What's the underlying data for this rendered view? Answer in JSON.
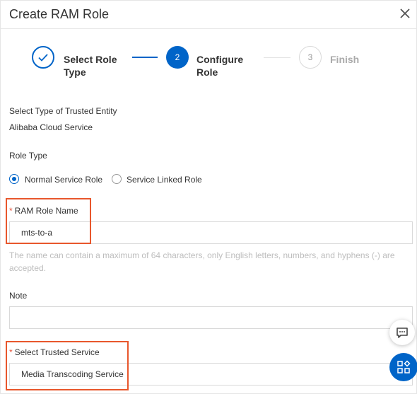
{
  "dialog": {
    "title": "Create RAM Role"
  },
  "steps": [
    {
      "number": "1",
      "label": "Select Role Type",
      "status": "completed"
    },
    {
      "number": "2",
      "label": "Configure Role",
      "status": "active"
    },
    {
      "number": "3",
      "label": "Finish",
      "status": "pending"
    }
  ],
  "form": {
    "trusted_entity_label": "Select Type of Trusted Entity",
    "trusted_entity_value": "Alibaba Cloud Service",
    "role_type_label": "Role Type",
    "role_type_options": [
      {
        "label": "Normal Service Role",
        "selected": true
      },
      {
        "label": "Service Linked Role",
        "selected": false
      }
    ],
    "required_mark": "*",
    "role_name_label": "RAM Role Name",
    "role_name_value": "mts-to-a",
    "role_name_hint": "The name can contain a maximum of 64 characters, only English letters, numbers, and hyphens (-) are accepted.",
    "note_label": "Note",
    "note_value": "",
    "trusted_service_label": "Select Trusted Service",
    "trusted_service_value": "Media Transcoding Service"
  },
  "colors": {
    "accent": "#0064c8",
    "highlight": "#e8572c",
    "required": "#e5533a"
  },
  "icons": {
    "close": "close-icon",
    "check": "check-icon",
    "chat": "chat-icon",
    "apps": "apps-icon"
  }
}
